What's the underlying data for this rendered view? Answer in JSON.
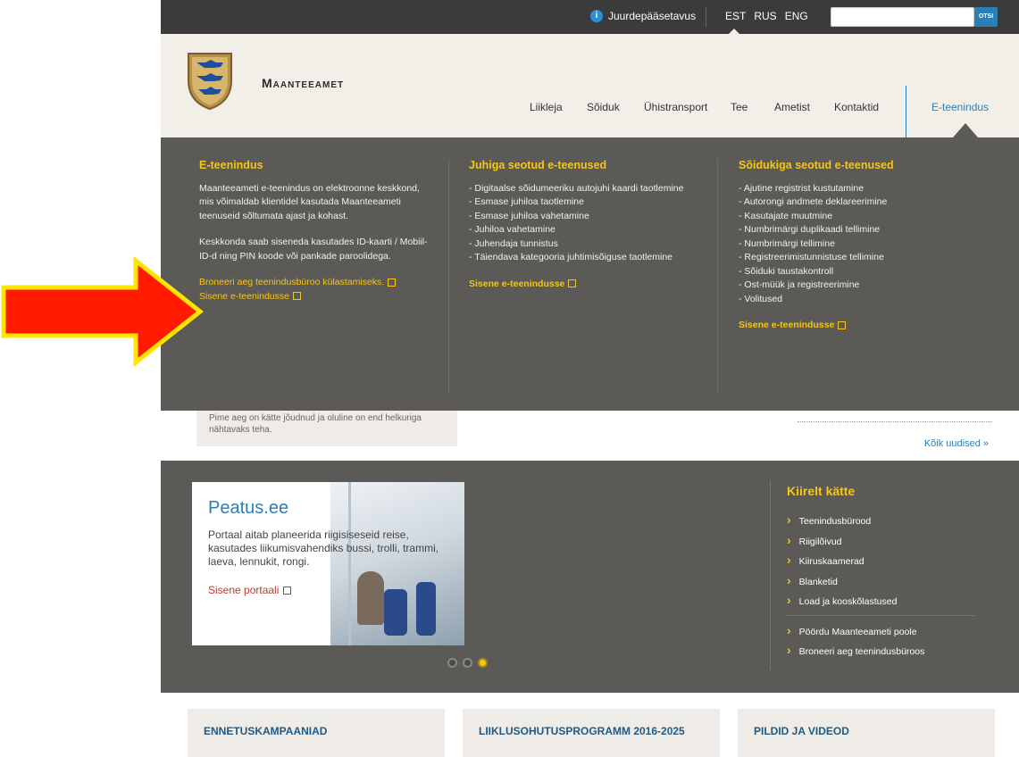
{
  "topbar": {
    "accessibility_label": "Juurdepääsetavus",
    "languages": [
      "EST",
      "RUS",
      "ENG"
    ],
    "search_value": "",
    "search_button_label": "OTSI"
  },
  "header": {
    "brand": "Maanteeamet",
    "nav_items": [
      "Liikleja",
      "Sõiduk",
      "Ühistransport",
      "Tee",
      "Ametist",
      "Kontaktid"
    ],
    "nav_active": "E-teenindus"
  },
  "dropdown": {
    "col1": {
      "title": "E-teenindus",
      "para1": "Maanteeameti e-teenindus on elektroonne keskkond, mis võimaldab klientidel kasutada Maanteeameti teenuseid sõltumata ajast ja kohast.",
      "para2": "Keskkonda saab siseneda kasutades ID-kaarti / Mobiil-ID-d ning PIN koode või pankade paroolidega.",
      "link1": "Broneeri aeg teenindusbüroo külastamiseks.",
      "link2": "Sisene e-teenindusse"
    },
    "col2": {
      "title": "Juhiga seotud e-teenused",
      "items": [
        "- Digitaalse sõidumeeriku autojuhi kaardi taotlemine",
        "- Esmase juhiloa taotlemine",
        "- Esmase juhiloa vahetamine",
        "- Juhiloa vahetamine",
        "- Juhendaja tunnistus",
        "- Täiendava kategooria juhtimisõiguse taotlemine"
      ],
      "link": "Sisene e-teenindusse"
    },
    "col3": {
      "title": "Sõidukiga seotud e-teenused",
      "items": [
        "- Ajutine registrist kustutamine",
        "- Autorongi andmete deklareerimine",
        "- Kasutajate muutmine",
        "- Numbrimärgi duplikaadi tellimine",
        "- Numbrimärgi tellimine",
        "- Registreerimistunnistuse tellimine",
        "- Sõiduki taustakontroll",
        "- Ost-müük ja registreerimine",
        "- Volitused"
      ],
      "link": "Sisene e-teenindusse"
    }
  },
  "content": {
    "tip_text": "Pime aeg on kätte jõudnud ja oluline on end helkuriga nähtavaks teha.",
    "all_news": "Kõik uudised »"
  },
  "promo": {
    "title": "Peatus.ee",
    "description": "Portaal aitab planeerida riigisiseseid reise, kasutades liikumisvahendiks bussi, trolli, trammi, laeva, lennukit, rongi.",
    "link": "Sisene portaali"
  },
  "quick": {
    "title": "Kiirelt kätte",
    "items": [
      "Teenindusbürood",
      "Riigilõivud",
      "Kiiruskaamerad",
      "Blanketid",
      "Load ja kooskõlastused"
    ],
    "items2": [
      "Pöördu Maanteeameti poole",
      "Broneeri aeg teenindusbüroos"
    ]
  },
  "bottom": {
    "cards": [
      "ENNETUSKAMPAANIAD",
      "LIIKLUSOHUTUSPROGRAMM 2016-2025",
      "PILDID JA VIDEOD"
    ]
  },
  "colors": {
    "dark_bar": "#3b3b3b",
    "panel": "#5b5a56",
    "accent_yellow": "#f5c518",
    "link_blue": "#2a7fb6",
    "arrow_red": "#ff1a00",
    "arrow_outline": "#ffe600"
  }
}
